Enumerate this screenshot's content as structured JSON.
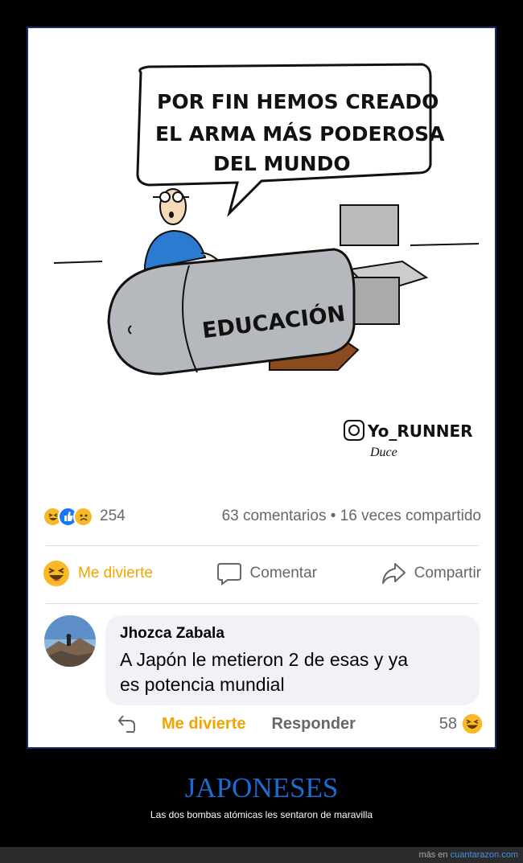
{
  "comic": {
    "speech": [
      "POR FIN HEMOS CREADO",
      "EL ARMA MÁS PODEROSA",
      "DEL MUNDO"
    ],
    "bomb_label": "EDUCACIÓN",
    "signature": "Yo_RUNNER",
    "signature2": "Duce"
  },
  "post": {
    "reaction_count": "254",
    "summary": "63 comentarios • 16 veces compartido",
    "actions": {
      "react": "Me divierte",
      "comment": "Comentar",
      "share": "Compartir"
    }
  },
  "comment": {
    "author": "Jhozca Zabala",
    "text_line1": "A Japón le metieron 2 de esas y ya",
    "text_line2": "es potencia mundial",
    "like_label": "Me divierte",
    "reply_label": "Responder",
    "count": "58"
  },
  "page": {
    "title": "JAPONESES",
    "subtitle": "Las dos bombas atómicas les sentaron de maravilla",
    "footer_prefix": "más en",
    "footer_site": "cuantarazon.com"
  },
  "colors": {
    "accent": "#1d6ad1",
    "haha": "#f7b928",
    "like": "#1877f2"
  }
}
